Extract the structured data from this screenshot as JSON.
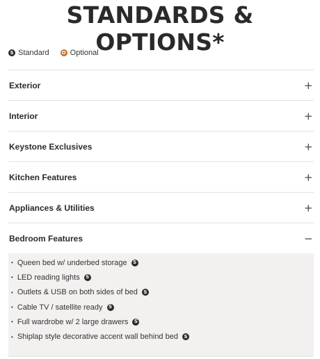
{
  "page": {
    "title": "STANDARDS & OPTIONS*"
  },
  "legend": {
    "standard": {
      "badge": "S",
      "label": "Standard"
    },
    "optional": {
      "badge": "O",
      "label": "Optional"
    }
  },
  "sections": [
    {
      "title": "Exterior",
      "toggle": "+"
    },
    {
      "title": "Interior",
      "toggle": "+"
    },
    {
      "title": "Keystone Exclusives",
      "toggle": "+"
    },
    {
      "title": "Kitchen Features",
      "toggle": "+"
    },
    {
      "title": "Appliances & Utilities",
      "toggle": "+"
    },
    {
      "title": "Bedroom Features",
      "toggle": "−"
    }
  ],
  "bedroom_items": [
    {
      "text": "Queen bed w/ underbed storage",
      "badge": "S"
    },
    {
      "text": "LED reading lights",
      "badge": "S"
    },
    {
      "text": "Outlets & USB on both sides of bed",
      "badge": "S"
    },
    {
      "text": "Cable TV / satellite ready",
      "badge": "S"
    },
    {
      "text": "Full wardrobe w/ 2 large drawers",
      "badge": "S"
    },
    {
      "text": "Shiplap style decorative accent wall behind bed",
      "badge": "S"
    }
  ],
  "colors": {
    "standard_badge": "#2b2b2b",
    "optional_badge": "#c0702f",
    "panel_bg": "#f3f0f0"
  }
}
